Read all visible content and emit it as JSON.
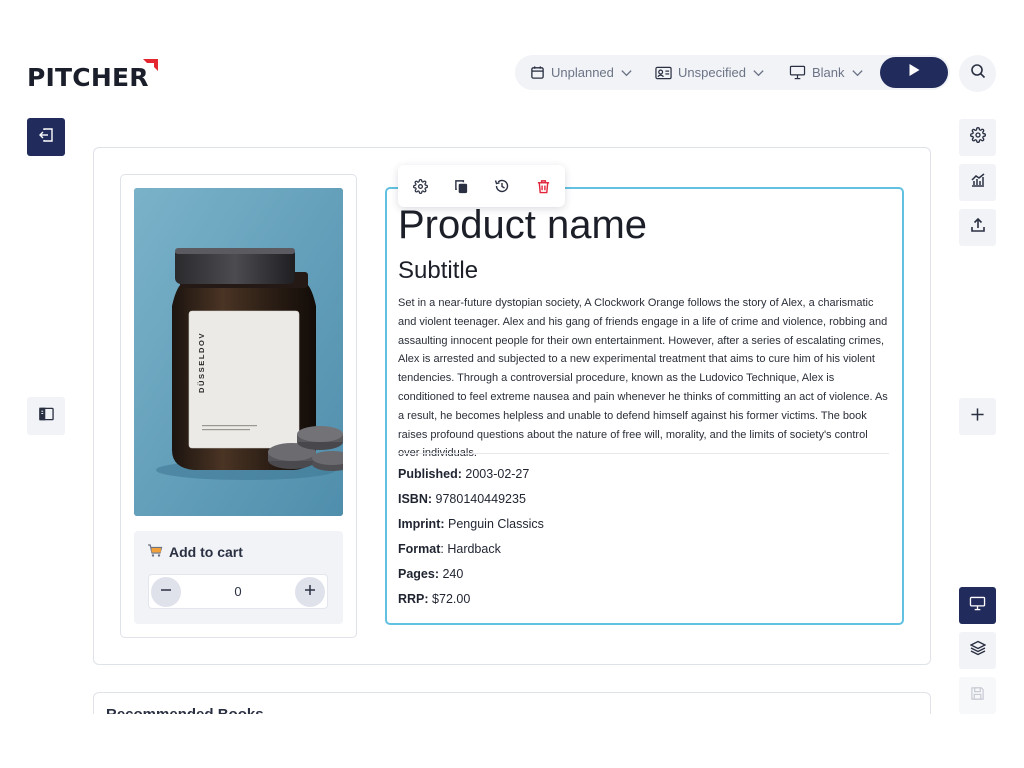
{
  "brand": {
    "logo_text": "PITCHER"
  },
  "topbar": {
    "schedule_label": "Unplanned",
    "contact_label": "Unspecified",
    "presentation_label": "Blank"
  },
  "product": {
    "title": "Product name",
    "subtitle": "Subtitle",
    "description": "Set in a near-future dystopian society, A Clockwork Orange follows the story of Alex, a charismatic and violent teenager. Alex and his gang of friends engage in a life of crime and violence, robbing and assaulting innocent people for their own entertainment. However, after a series of escalating crimes, Alex is arrested and subjected to a new experimental treatment that aims to cure him of his violent tendencies. Through a controversial procedure, known as the Ludovico Technique, Alex is conditioned to feel extreme nausea and pain whenever he thinks of committing an act of violence. As a result, he becomes helpless and unable to defend himself against his former victims. The book raises profound questions about the nature of free will, morality, and the limits of society's control over individuals.",
    "image_label": "DÜSSELDOV",
    "meta": [
      {
        "label": "Published:",
        "value": "2003-02-27"
      },
      {
        "label": "ISBN:",
        "value": "9780140449235"
      },
      {
        "label": "Imprint:",
        "value": "Penguin Classics"
      },
      {
        "label": "Format",
        "sep": ":",
        "value": "Hardback"
      },
      {
        "label": "Pages:",
        "value": "240"
      },
      {
        "label": "RRP:",
        "value": "$72.00"
      }
    ]
  },
  "cart": {
    "label": "Add to cart",
    "quantity": "0"
  },
  "recommended": {
    "title": "Recommended Books"
  },
  "colors": {
    "primary": "#222c5c",
    "accent": "#62c1e0",
    "danger": "#e0243a",
    "brand_red": "#e3262f",
    "surface": "#f1f3f7"
  },
  "icons": {
    "topbar": [
      "calendar-icon",
      "contact-card-icon",
      "presentation-icon",
      "play-icon",
      "search-icon"
    ],
    "toolbar": [
      "gear-icon",
      "copy-icon",
      "history-icon",
      "trash-icon"
    ],
    "right_rail": [
      "gear-icon",
      "analytics-icon",
      "upload-icon",
      "plus-icon",
      "presentation-icon",
      "layers-icon",
      "save-icon"
    ],
    "left_rail": [
      "exit-icon",
      "sidebar-panel-icon"
    ]
  }
}
